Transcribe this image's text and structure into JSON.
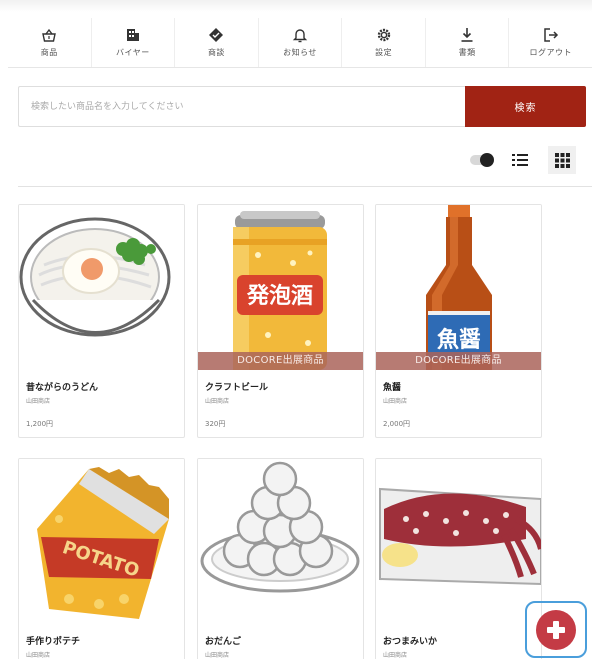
{
  "nav": {
    "items": [
      {
        "label": "商品",
        "icon": "basket-icon"
      },
      {
        "label": "バイヤー",
        "icon": "building-icon"
      },
      {
        "label": "商談",
        "icon": "handshake-icon"
      },
      {
        "label": "お知らせ",
        "icon": "bell-icon"
      },
      {
        "label": "設定",
        "icon": "gear-icon"
      },
      {
        "label": "書類",
        "icon": "download-icon"
      },
      {
        "label": "ログアウト",
        "icon": "logout-icon"
      }
    ]
  },
  "search": {
    "placeholder": "検索したい商品名を入力してください",
    "button_label": "検索"
  },
  "view": {
    "toggle_on": true,
    "active_view": "grid"
  },
  "ribbon_label": "DOCORE出展商品",
  "products": [
    {
      "name": "昔ながらのうどん",
      "shop": "山田商店",
      "price": "1,200円",
      "ribbon": false,
      "image": "udon"
    },
    {
      "name": "クラフトビール",
      "shop": "山田商店",
      "price": "320円",
      "ribbon": true,
      "image": "beer-can"
    },
    {
      "name": "魚醤",
      "shop": "山田商店",
      "price": "2,000円",
      "ribbon": true,
      "image": "sauce-bottle"
    },
    {
      "name": "手作りポテチ",
      "shop": "山田商店",
      "price": "",
      "ribbon": false,
      "image": "potato-chips"
    },
    {
      "name": "おだんご",
      "shop": "山田商店",
      "price": "",
      "ribbon": false,
      "image": "dango"
    },
    {
      "name": "おつまみいか",
      "shop": "山田商店",
      "price": "",
      "ribbon": false,
      "image": "squid"
    }
  ],
  "image_text": {
    "beer_can_label": "発泡酒",
    "sauce_label": "魚醤",
    "chips_label": "POTATO"
  },
  "colors": {
    "accent": "#a12314",
    "fab": "#c43b45",
    "fab_ring": "#4a9edb"
  }
}
